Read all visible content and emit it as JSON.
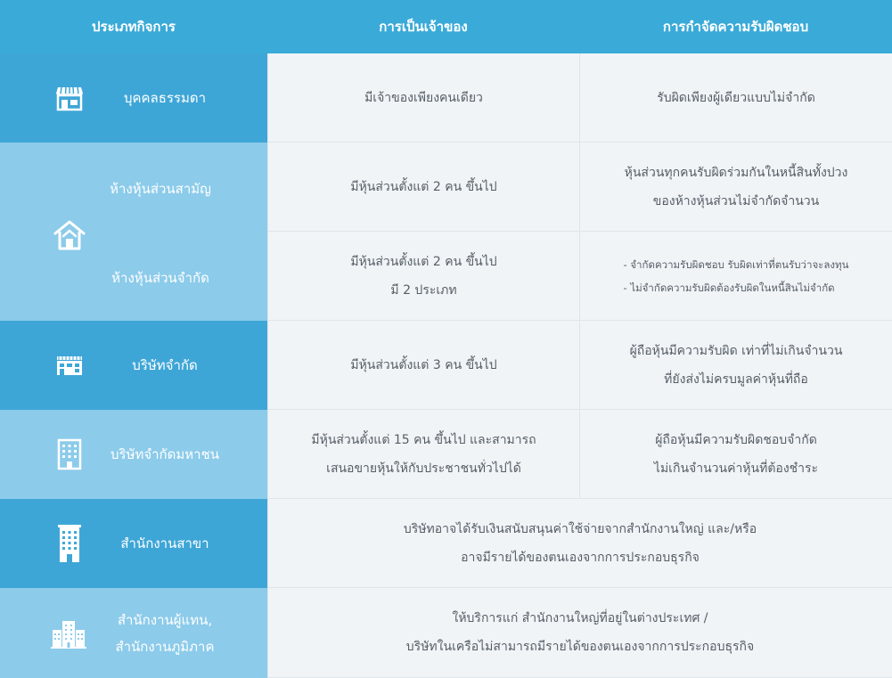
{
  "headers": [
    "ประเภทกิจการ",
    "การเป็นเจ้าของ",
    "การกำจัดความรับผิดชอบ"
  ],
  "rows": {
    "sole": {
      "type": "บุคคลธรรมดา",
      "icon": "storefront-icon",
      "ownership": [
        "มีเจ้าของเพียงคนเดียว"
      ],
      "liability": [
        "รับผิดเพียงผู้เดียวแบบไม่จำกัด"
      ]
    },
    "partnership": {
      "icon": "house-icon",
      "ordinary": {
        "type": "ห้างหุ้นส่วนสามัญ",
        "ownership": [
          "มีหุ้นส่วนตั้งแต่ 2 คน ขึ้นไป"
        ],
        "liability": [
          "หุ้นส่วนทุกคนรับผิดร่วมกันในหนี้สินทั้งปวง",
          "ของห้างหุ้นส่วนไม่จำกัดจำนวน"
        ]
      },
      "limited": {
        "type": "ห้างหุ้นส่วนจำกัด",
        "ownership": [
          "มีหุ้นส่วนตั้งแต่ 2 คน ขึ้นไป",
          "มี 2 ประเภท"
        ],
        "liability": [
          "- จำกัดความรับผิดชอบ รับผิดเท่าที่ตนรับว่าจะลงทุน",
          "- ไม่จำกัดความรับผิดต้องรับผิดในหนี้สินไม่จำกัด"
        ]
      }
    },
    "company": {
      "type": "บริษัทจำกัด",
      "icon": "shop-building-icon",
      "ownership": [
        "มีหุ้นส่วนตั้งแต่ 3 คน ขึ้นไป"
      ],
      "liability": [
        "ผู้ถือหุ้นมีความรับผิด เท่าที่ไม่เกินจำนวน",
        "ที่ยังส่งไม่ครบมูลค่าหุ้นที่ถือ"
      ]
    },
    "public": {
      "type": "บริษัทจำกัดมหาชน",
      "icon": "office-building-icon",
      "ownership": [
        "มีหุ้นส่วนตั้งแต่ 15 คน ขึ้นไป และสามารถ",
        "เสนอขายหุ้นให้กับประชาชนทั่วไปได้"
      ],
      "liability": [
        "ผู้ถือหุ้นมีความรับผิดชอบจำกัด",
        "ไม่เกินจำนวนค่าหุ้นที่ต้องชำระ"
      ]
    },
    "branch": {
      "type": "สำนักงานสาขา",
      "icon": "tower-building-icon",
      "description": [
        "บริษัทอาจได้รับเงินสนับสนุนค่าใช้จ่ายจากสำนักงานใหญ่ และ/หรือ",
        "อาจมีรายได้ของตนเองจากการประกอบธุรกิจ"
      ]
    },
    "representative": {
      "type": [
        "สำนักงานผู้แทน,",
        "สำนักงานภูมิภาค"
      ],
      "icon": "city-buildings-icon",
      "description": [
        "ให้บริการแก่ สำนักงานใหญ่ที่อยู่ในต่างประเทศ /",
        "บริษัทในเครือไม่สามารถมีรายได้ของตนเองจากการประกอบธุรกิจ"
      ]
    }
  },
  "colors": {
    "header": "#3aaad8",
    "type_dark": "#3ea6d7",
    "type_light": "#8ccbea",
    "cell_bg": "#f1f4f7",
    "cell_text": "#555e66"
  }
}
